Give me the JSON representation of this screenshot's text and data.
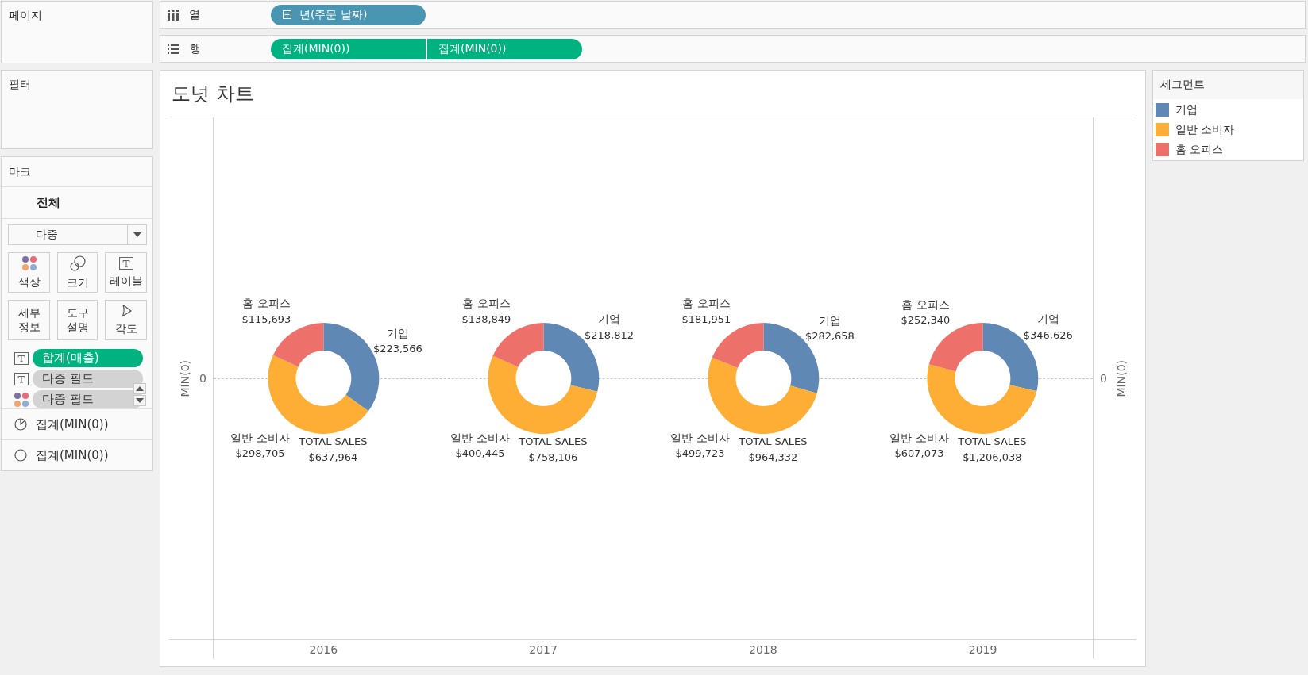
{
  "pages_panel": {
    "title": "페이지"
  },
  "columns_shelf": {
    "label": "열",
    "pills": [
      {
        "label": "년(주문 날짜)",
        "color": "#4a95b1",
        "expandable": true
      }
    ]
  },
  "rows_shelf": {
    "label": "행",
    "pills": [
      {
        "label": "집계(MIN(0))",
        "color": "#00b27f",
        "expandable": false
      },
      {
        "label": "집계(MIN(0))",
        "color": "#00b27f",
        "expandable": false
      }
    ]
  },
  "filters_panel": {
    "title": "필터"
  },
  "marks_card": {
    "title": "마크",
    "tab": "전체",
    "mark_type": "다중",
    "properties": [
      {
        "kind": "color",
        "label": "색상"
      },
      {
        "kind": "size",
        "label": "크기"
      },
      {
        "kind": "label",
        "label": "레이블"
      },
      {
        "kind": "detail",
        "label": "세부 정보"
      },
      {
        "kind": "tooltip",
        "label": "도구 설명"
      },
      {
        "kind": "angle",
        "label": "각도"
      }
    ],
    "fields": [
      {
        "kind": "label",
        "color": "#00b27f",
        "label": "합계(매출)"
      },
      {
        "kind": "label",
        "color": "#d3d3d3",
        "label": "다중 필드"
      },
      {
        "kind": "color",
        "color": "#d3d3d3",
        "label": "다중 필드"
      }
    ],
    "layers": [
      {
        "kind": "pie",
        "label": "집계(MIN(0))"
      },
      {
        "kind": "circle",
        "label": "집계(MIN(0))"
      }
    ]
  },
  "view": {
    "title": "도넛 차트",
    "y_axis": {
      "title": "MIN(0)",
      "tick": "0"
    },
    "y2_axis": {
      "title": "MIN(0)",
      "tick": "0"
    },
    "x_axis": {
      "labels": [
        "2016",
        "2017",
        "2018",
        "2019"
      ]
    },
    "chart_data": [
      {
        "type": "donut",
        "categories": [
          "기업",
          "일반 소비자",
          "홈 오피스"
        ],
        "values": [
          223566,
          298705,
          115693
        ],
        "colors": [
          "#6088b4",
          "#feae34",
          "#ee706a"
        ],
        "value_labels": [
          "$223,566",
          "$298,705",
          "$115,693"
        ],
        "annotations": [
          "TOTAL SALES",
          "$637,964"
        ]
      },
      {
        "type": "donut",
        "categories": [
          "기업",
          "일반 소비자",
          "홈 오피스"
        ],
        "values": [
          218812,
          400445,
          138849
        ],
        "colors": [
          "#6088b4",
          "#feae34",
          "#ee706a"
        ],
        "value_labels": [
          "$218,812",
          "$400,445",
          "$138,849"
        ],
        "annotations": [
          "TOTAL SALES",
          "$758,106"
        ]
      },
      {
        "type": "donut",
        "categories": [
          "기업",
          "일반 소비자",
          "홈 오피스"
        ],
        "values": [
          282658,
          499723,
          181951
        ],
        "colors": [
          "#6088b4",
          "#feae34",
          "#ee706a"
        ],
        "value_labels": [
          "$282,658",
          "$499,723",
          "$181,951"
        ],
        "annotations": [
          "TOTAL SALES",
          "$964,332"
        ]
      },
      {
        "type": "donut",
        "categories": [
          "기업",
          "일반 소비자",
          "홈 오피스"
        ],
        "values": [
          346626,
          607073,
          252340
        ],
        "colors": [
          "#6088b4",
          "#feae34",
          "#ee706a"
        ],
        "value_labels": [
          "$346,626",
          "$607,073",
          "$252,340"
        ],
        "annotations": [
          "TOTAL SALES",
          "$1,206,038"
        ]
      }
    ]
  },
  "legend": {
    "title": "세그먼트",
    "items": [
      {
        "label": "기업",
        "color": "#6088b4"
      },
      {
        "label": "일반 소비자",
        "color": "#feae34"
      },
      {
        "label": "홈 오피스",
        "color": "#ee706a"
      }
    ]
  }
}
